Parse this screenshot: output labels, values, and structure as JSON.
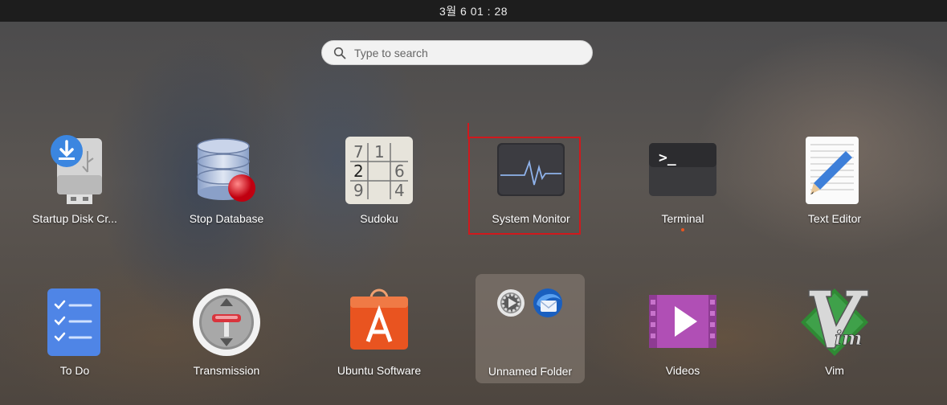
{
  "topbar": {
    "clock": "3월 6  01 : 28"
  },
  "search": {
    "placeholder": "Type to search"
  },
  "apps": {
    "startup_disk": "Startup Disk Cr...",
    "stop_database": "Stop Database",
    "sudoku": "Sudoku",
    "system_monitor": "System Monitor",
    "terminal": "Terminal",
    "text_editor": "Text Editor",
    "todo": "To Do",
    "transmission": "Transmission",
    "ubuntu_software": "Ubuntu Software",
    "unnamed_folder": "Unnamed Folder",
    "videos": "Videos",
    "vim": "Vim"
  },
  "sudoku_digits": [
    "7",
    "1",
    "2",
    "6",
    "9",
    "4"
  ],
  "terminal_prompt": ">_",
  "accent_colors": {
    "highlight": "#d0191d",
    "running_indicator": "#e95420"
  }
}
